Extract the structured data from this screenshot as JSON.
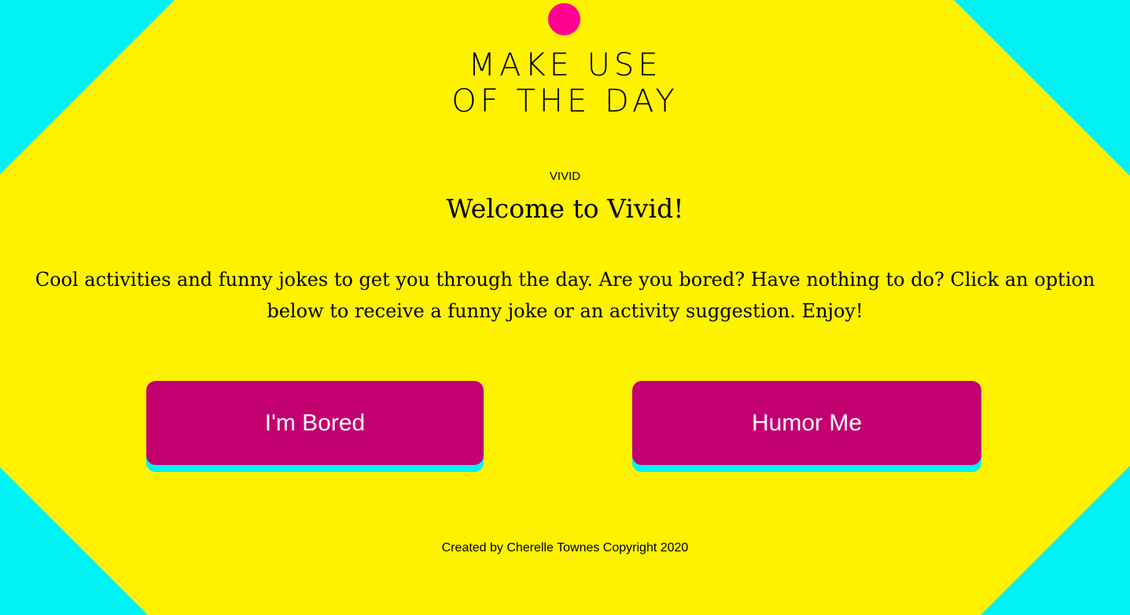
{
  "colors": {
    "background": "#fff200",
    "corner": "#00f2f7",
    "dot": "#ff0090",
    "button": "#c2006f",
    "button_shadow": "#00f2f7",
    "button_text": "#ffffff"
  },
  "logo": {
    "line1": "MAKE USE",
    "line2": "OF THE DAY"
  },
  "header": {
    "eyebrow": "VIVID",
    "title": "Welcome to Vivid!"
  },
  "main": {
    "description": "Cool activities and funny jokes to get you through the day. Are you bored? Have nothing to do? Click an option below to receive a funny joke or an activity suggestion. Enjoy!"
  },
  "buttons": {
    "bored_label": "I'm Bored",
    "humor_label": "Humor Me"
  },
  "footer": {
    "text": "Created by Cherelle Townes Copyright 2020"
  }
}
